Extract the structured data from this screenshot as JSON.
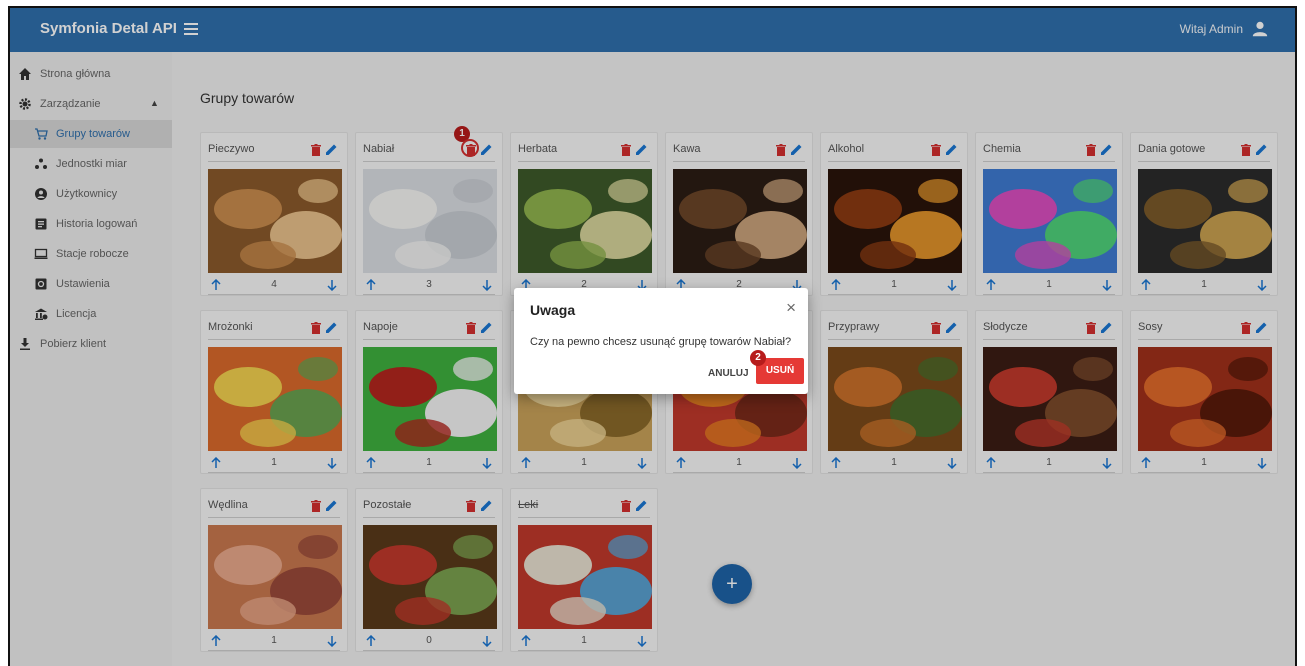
{
  "header": {
    "app_title": "Symfonia Detal API",
    "greeting": "Witaj Admin"
  },
  "sidebar": {
    "items": [
      {
        "label": "Strona główna",
        "icon": "home-icon"
      },
      {
        "label": "Zarządzanie",
        "icon": "gear-icon",
        "expanded": true
      },
      {
        "label": "Grupy towarów",
        "icon": "cart-icon",
        "active": true
      },
      {
        "label": "Jednostki miar",
        "icon": "dots-icon"
      },
      {
        "label": "Użytkownicy",
        "icon": "users-icon"
      },
      {
        "label": "Historia logowań",
        "icon": "history-icon"
      },
      {
        "label": "Stacje robocze",
        "icon": "monitor-icon"
      },
      {
        "label": "Ustawienia",
        "icon": "settings-icon"
      },
      {
        "label": "Licencja",
        "icon": "license-icon"
      },
      {
        "label": "Pobierz klient",
        "icon": "download-icon"
      }
    ]
  },
  "main": {
    "title": "Grupy towarów",
    "groups": [
      {
        "name": "Pieczywo",
        "count": "4"
      },
      {
        "name": "Nabiał",
        "count": "3"
      },
      {
        "name": "Herbata",
        "count": "2"
      },
      {
        "name": "Kawa",
        "count": "2"
      },
      {
        "name": "Alkohol",
        "count": "1"
      },
      {
        "name": "Chemia",
        "count": "1"
      },
      {
        "name": "Dania gotowe",
        "count": "1"
      },
      {
        "name": "Mrożonki",
        "count": "1"
      },
      {
        "name": "Napoje",
        "count": "1"
      },
      {
        "name": "",
        "count": "1"
      },
      {
        "name": "",
        "count": "1"
      },
      {
        "name": "Przyprawy",
        "count": "1"
      },
      {
        "name": "Słodycze",
        "count": "1"
      },
      {
        "name": "Sosy",
        "count": "1"
      },
      {
        "name": "Wędlina",
        "count": "1"
      },
      {
        "name": "Pozostałe",
        "count": "0"
      },
      {
        "name": "Leki",
        "count": "1",
        "struck": true
      }
    ]
  },
  "dialog": {
    "title": "Uwaga",
    "close_label": "×",
    "message": "Czy na pewno chcesz usunąć grupę towarów Nabiał?",
    "cancel_label": "ANULUJ",
    "delete_label": "USUŃ"
  },
  "annotations": {
    "step1": "1",
    "step2": "2"
  },
  "fab_label": "+",
  "colors": {
    "header_bg": "#2f6fac",
    "accent": "#1976d2",
    "danger": "#e53935",
    "step_badge": "#b71c1c"
  }
}
